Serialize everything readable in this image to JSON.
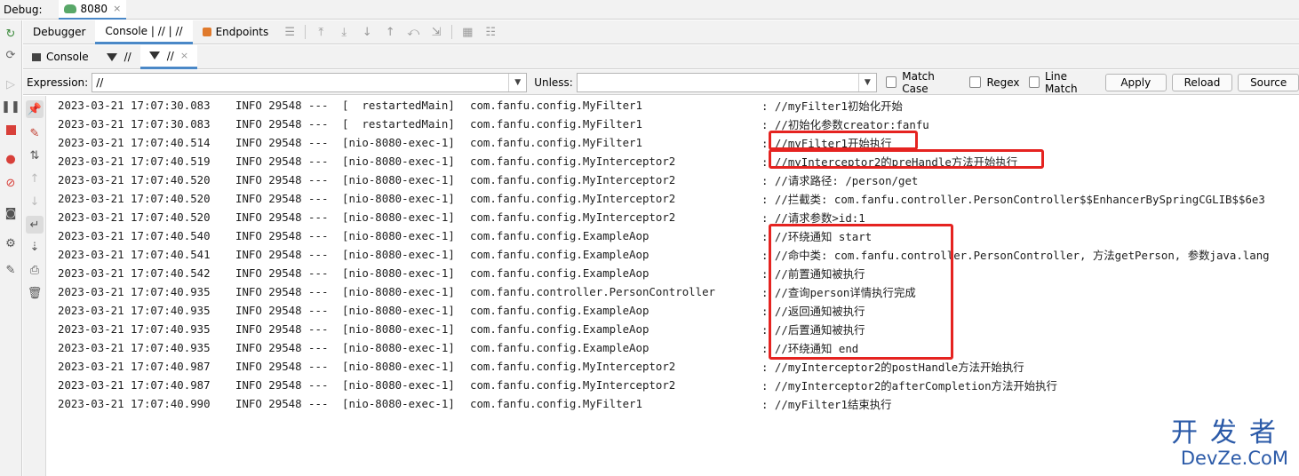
{
  "titlebar": {
    "label": "Debug:",
    "run_tab": "8080",
    "close_glyph": "×"
  },
  "tabs": {
    "debugger": "Debugger",
    "console": "Console | // | //",
    "endpoints": "Endpoints"
  },
  "subtabs": {
    "console": "Console",
    "filter1": "//",
    "filter2": "//",
    "close_glyph": "×"
  },
  "filter": {
    "expression_label": "Expression:",
    "expression_value": "//",
    "unless_label": "Unless:",
    "unless_value": "",
    "match_case": "Match Case",
    "regex": "Regex",
    "line_match": "Line Match",
    "apply": "Apply",
    "reload": "Reload",
    "source": "Source"
  },
  "log": [
    {
      "ts": "2023-03-21 17:07:30.083",
      "level": "INFO 29548 ---",
      "thread": "[  restartedMain]",
      "class": "com.fanfu.config.MyFilter1",
      "msg": ": //myFilter1初始化开始"
    },
    {
      "ts": "2023-03-21 17:07:30.083",
      "level": "INFO 29548 ---",
      "thread": "[  restartedMain]",
      "class": "com.fanfu.config.MyFilter1",
      "msg": ": //初始化参数creator:fanfu"
    },
    {
      "ts": "2023-03-21 17:07:40.514",
      "level": "INFO 29548 ---",
      "thread": "[nio-8080-exec-1]",
      "class": "com.fanfu.config.MyFilter1",
      "msg": ": //myFilter1开始执行"
    },
    {
      "ts": "2023-03-21 17:07:40.519",
      "level": "INFO 29548 ---",
      "thread": "[nio-8080-exec-1]",
      "class": "com.fanfu.config.MyInterceptor2",
      "msg": ": //myInterceptor2的preHandle方法开始执行"
    },
    {
      "ts": "2023-03-21 17:07:40.520",
      "level": "INFO 29548 ---",
      "thread": "[nio-8080-exec-1]",
      "class": "com.fanfu.config.MyInterceptor2",
      "msg": ": //请求路径: /person/get"
    },
    {
      "ts": "2023-03-21 17:07:40.520",
      "level": "INFO 29548 ---",
      "thread": "[nio-8080-exec-1]",
      "class": "com.fanfu.config.MyInterceptor2",
      "msg": ": //拦截类: com.fanfu.controller.PersonController$$EnhancerBySpringCGLIB$$6e3"
    },
    {
      "ts": "2023-03-21 17:07:40.520",
      "level": "INFO 29548 ---",
      "thread": "[nio-8080-exec-1]",
      "class": "com.fanfu.config.MyInterceptor2",
      "msg": ": //请求参数>id:1"
    },
    {
      "ts": "2023-03-21 17:07:40.540",
      "level": "INFO 29548 ---",
      "thread": "[nio-8080-exec-1]",
      "class": "com.fanfu.config.ExampleAop",
      "msg": ": //环绕通知 start"
    },
    {
      "ts": "2023-03-21 17:07:40.541",
      "level": "INFO 29548 ---",
      "thread": "[nio-8080-exec-1]",
      "class": "com.fanfu.config.ExampleAop",
      "msg": ": //命中类: com.fanfu.controller.PersonController, 方法getPerson, 参数java.lang"
    },
    {
      "ts": "2023-03-21 17:07:40.542",
      "level": "INFO 29548 ---",
      "thread": "[nio-8080-exec-1]",
      "class": "com.fanfu.config.ExampleAop",
      "msg": ": //前置通知被执行"
    },
    {
      "ts": "2023-03-21 17:07:40.935",
      "level": "INFO 29548 ---",
      "thread": "[nio-8080-exec-1]",
      "class": "com.fanfu.controller.PersonController",
      "msg": ": //查询person详情执行完成"
    },
    {
      "ts": "2023-03-21 17:07:40.935",
      "level": "INFO 29548 ---",
      "thread": "[nio-8080-exec-1]",
      "class": "com.fanfu.config.ExampleAop",
      "msg": ": //返回通知被执行"
    },
    {
      "ts": "2023-03-21 17:07:40.935",
      "level": "INFO 29548 ---",
      "thread": "[nio-8080-exec-1]",
      "class": "com.fanfu.config.ExampleAop",
      "msg": ": //后置通知被执行"
    },
    {
      "ts": "2023-03-21 17:07:40.935",
      "level": "INFO 29548 ---",
      "thread": "[nio-8080-exec-1]",
      "class": "com.fanfu.config.ExampleAop",
      "msg": ": //环绕通知 end"
    },
    {
      "ts": "2023-03-21 17:07:40.987",
      "level": "INFO 29548 ---",
      "thread": "[nio-8080-exec-1]",
      "class": "com.fanfu.config.MyInterceptor2",
      "msg": ": //myInterceptor2的postHandle方法开始执行"
    },
    {
      "ts": "2023-03-21 17:07:40.987",
      "level": "INFO 29548 ---",
      "thread": "[nio-8080-exec-1]",
      "class": "com.fanfu.config.MyInterceptor2",
      "msg": ": //myInterceptor2的afterCompletion方法开始执行"
    },
    {
      "ts": "2023-03-21 17:07:40.990",
      "level": "INFO 29548 ---",
      "thread": "[nio-8080-exec-1]",
      "class": "com.fanfu.config.MyFilter1",
      "msg": ": //myFilter1结束执行"
    }
  ],
  "watermark": {
    "top": "开发者",
    "bottom": "DevZe.CoM"
  },
  "colors": {
    "highlight": "#e52320",
    "accent": "#4a88c7",
    "watermark": "#2b5aa8"
  }
}
